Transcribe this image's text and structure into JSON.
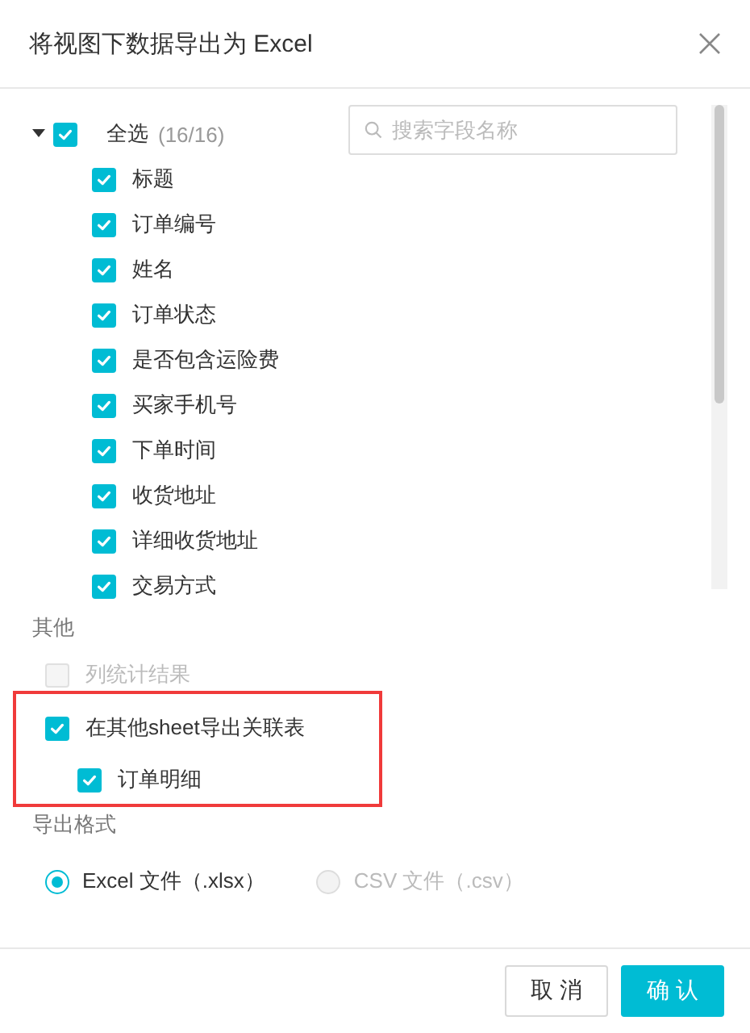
{
  "dialog": {
    "title": "将视图下数据导出为 Excel"
  },
  "fields": {
    "select_all": {
      "label": "全选",
      "count": "(16/16)",
      "checked": true,
      "expanded": true
    },
    "items": [
      {
        "label": "标题",
        "checked": true
      },
      {
        "label": "订单编号",
        "checked": true
      },
      {
        "label": "姓名",
        "checked": true
      },
      {
        "label": "订单状态",
        "checked": true
      },
      {
        "label": "是否包含运险费",
        "checked": true
      },
      {
        "label": "买家手机号",
        "checked": true
      },
      {
        "label": "下单时间",
        "checked": true
      },
      {
        "label": "收货地址",
        "checked": true
      },
      {
        "label": "详细收货地址",
        "checked": true
      },
      {
        "label": "交易方式",
        "checked": true
      }
    ]
  },
  "search": {
    "placeholder": "搜索字段名称"
  },
  "other": {
    "heading": "其他",
    "options": [
      {
        "label": "列统计结果",
        "checked": false,
        "disabled": true
      },
      {
        "label": "在其他sheet导出关联表",
        "checked": true,
        "disabled": false,
        "children": [
          {
            "label": "订单明细",
            "checked": true,
            "disabled": false
          }
        ]
      }
    ]
  },
  "format": {
    "heading": "导出格式",
    "options": [
      {
        "label": "Excel 文件（.xlsx）",
        "selected": true,
        "disabled": false
      },
      {
        "label": "CSV 文件（.csv）",
        "selected": false,
        "disabled": true
      }
    ]
  },
  "buttons": [
    {
      "label": "取 消",
      "kind": "secondary"
    },
    {
      "label": "确 认",
      "kind": "primary"
    }
  ]
}
